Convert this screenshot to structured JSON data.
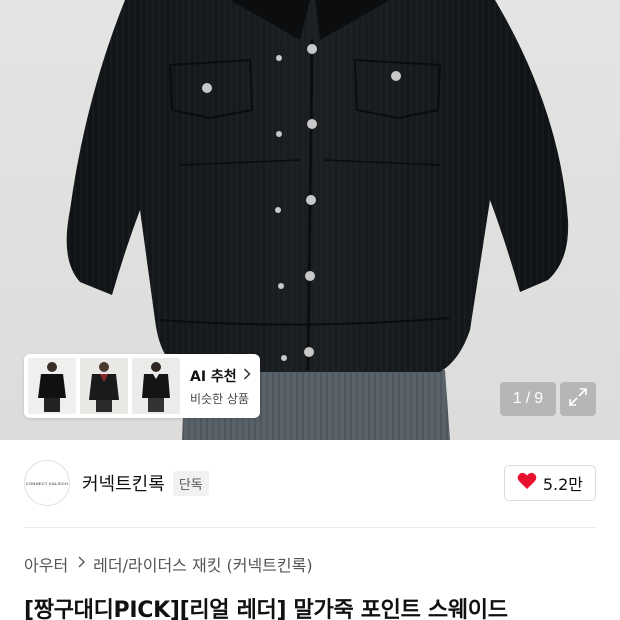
{
  "gallery": {
    "current": "1",
    "total": "9",
    "separator": "/",
    "image_count": 9,
    "current_index": 1
  },
  "recommendation": {
    "title": "AI 추천",
    "subtitle": "비슷한 상품",
    "chevron_icon": "chevron-right-icon"
  },
  "brand": {
    "logo_text": "CONNECT KALSICH",
    "name": "커넥트킨록",
    "badge": "단독"
  },
  "like": {
    "icon": "heart-icon",
    "count": "5.2만",
    "color": "#e8112d"
  },
  "breadcrumb": {
    "items": [
      "아우터",
      "레더/라이더스 재킷 (커넥트킨록)"
    ]
  },
  "product": {
    "title": "[짱구대디PICK][리얼 레더] 말가죽 포인트 스웨이드"
  },
  "colors": {
    "hero_bg": "#e0e0de",
    "jacket": "#16191c",
    "heart": "#e8112d"
  }
}
